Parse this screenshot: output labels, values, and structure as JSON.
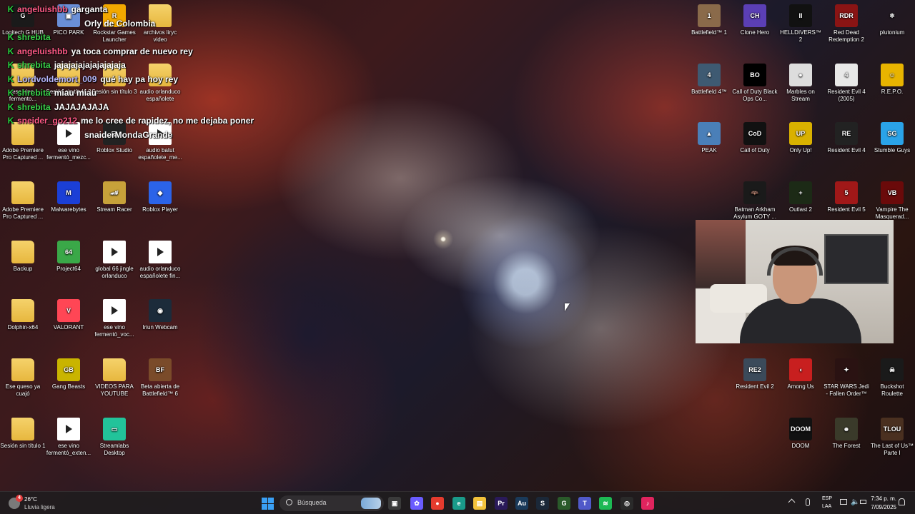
{
  "desktop_icons": [
    {
      "label": "Logitech G HUB",
      "kind": "app",
      "color": "#1a1a1a",
      "glyph": "G"
    },
    {
      "label": "PICO PARK",
      "kind": "app",
      "color": "#6a8fd8",
      "glyph": "▣"
    },
    {
      "label": "Rockstar Games Launcher",
      "kind": "app",
      "color": "#f2a800",
      "glyph": "R"
    },
    {
      "label": "archivos liryc video",
      "kind": "folder",
      "color": "",
      "glyph": ""
    },
    {
      "label": "ese vino fermento...",
      "kind": "folder",
      "color": "",
      "glyph": ""
    },
    {
      "label": "Sesión sin título 2",
      "kind": "folder",
      "color": "",
      "glyph": ""
    },
    {
      "label": "Sesión sin título 3",
      "kind": "folder",
      "color": "",
      "glyph": ""
    },
    {
      "label": "audio orlanduco españolete",
      "kind": "folder",
      "color": "",
      "glyph": ""
    },
    {
      "label": "Adobe Premiere Pro Captured ...",
      "kind": "folder",
      "color": "",
      "glyph": ""
    },
    {
      "label": "ese vino fermentó_mezc...",
      "kind": "video",
      "color": "",
      "glyph": ""
    },
    {
      "label": "Roblox Studio",
      "kind": "app",
      "color": "#222",
      "glyph": "◪"
    },
    {
      "label": "audio batut españolete_me...",
      "kind": "video",
      "color": "",
      "glyph": ""
    },
    {
      "label": "Adobe Premiere Pro Captured ...",
      "kind": "folder",
      "color": "",
      "glyph": ""
    },
    {
      "label": "Malwarebytes",
      "kind": "app",
      "color": "#1b3fd6",
      "glyph": "M"
    },
    {
      "label": "Stream Racer",
      "kind": "app",
      "color": "#c7a13a",
      "glyph": "🏎"
    },
    {
      "label": "Roblox Player",
      "kind": "app",
      "color": "#2b63e8",
      "glyph": "◆"
    },
    {
      "label": "Backup",
      "kind": "folder",
      "color": "",
      "glyph": ""
    },
    {
      "label": "Project64",
      "kind": "app",
      "color": "#3aa848",
      "glyph": "64"
    },
    {
      "label": "global 66 jingle orlanduco",
      "kind": "video",
      "color": "",
      "glyph": ""
    },
    {
      "label": "audio orlanduco españolete fin...",
      "kind": "video",
      "color": "",
      "glyph": ""
    },
    {
      "label": "Dolphin-x64",
      "kind": "folder",
      "color": "",
      "glyph": ""
    },
    {
      "label": "VALORANT",
      "kind": "app",
      "color": "#ff4655",
      "glyph": "V"
    },
    {
      "label": "ese vino fermentó_voc...",
      "kind": "video",
      "color": "",
      "glyph": ""
    },
    {
      "label": "Iriun Webcam",
      "kind": "app",
      "color": "#1c2b3a",
      "glyph": "◉"
    },
    {
      "label": "Ese queso ya cuajó",
      "kind": "folder",
      "color": "",
      "glyph": ""
    },
    {
      "label": "Gang Beasts",
      "kind": "app",
      "color": "#c9b400",
      "glyph": "GB"
    },
    {
      "label": "VIDEOS PARA YOUTUBE",
      "kind": "folder",
      "color": "",
      "glyph": ""
    },
    {
      "label": "Beta abierta de Battlefield™ 6",
      "kind": "app",
      "color": "#7a4b2a",
      "glyph": "BF"
    },
    {
      "label": "Sesión sin título 1",
      "kind": "folder",
      "color": "",
      "glyph": ""
    },
    {
      "label": "ese vino fermentó_exten...",
      "kind": "video",
      "color": "",
      "glyph": ""
    },
    {
      "label": "Streamlabs Desktop",
      "kind": "app",
      "color": "#22c39a",
      "glyph": "▭"
    },
    {
      "label": "Battlefield™ 1",
      "kind": "app",
      "color": "#8a6a4a",
      "glyph": "1"
    },
    {
      "label": "Clone Hero",
      "kind": "app",
      "color": "#5b3fb5",
      "glyph": "CH"
    },
    {
      "label": "HELLDIVERS™ 2",
      "kind": "app",
      "color": "#111",
      "glyph": "II"
    },
    {
      "label": "Red Dead Redemption 2",
      "kind": "app",
      "color": "#8a1414",
      "glyph": "RDR"
    },
    {
      "label": "plutonium",
      "kind": "app",
      "color": "transparent",
      "glyph": "⚛"
    },
    {
      "label": "Battlefield 4™",
      "kind": "app",
      "color": "#3e5a72",
      "glyph": "4"
    },
    {
      "label": "Call of Duty Black Ops Co...",
      "kind": "app",
      "color": "#000",
      "glyph": "BO"
    },
    {
      "label": "Marbles on Stream",
      "kind": "app",
      "color": "#ddd",
      "glyph": "●"
    },
    {
      "label": "Resident Evil 4 (2005)",
      "kind": "app",
      "color": "#e8e8e8",
      "glyph": "4"
    },
    {
      "label": "R.E.P.O.",
      "kind": "app",
      "color": "#e8b400",
      "glyph": "☺"
    },
    {
      "label": "PEAK",
      "kind": "app",
      "color": "#4a7fb8",
      "glyph": "▲"
    },
    {
      "label": "Call of Duty",
      "kind": "app",
      "color": "#111",
      "glyph": "CoD"
    },
    {
      "label": "Only Up!",
      "kind": "app",
      "color": "#d9b100",
      "glyph": "UP"
    },
    {
      "label": "Resident Evil 4",
      "kind": "app",
      "color": "#222",
      "glyph": "RE"
    },
    {
      "label": "Stumble Guys",
      "kind": "app",
      "color": "#2aa3e8",
      "glyph": "SG"
    },
    {
      "label": "Batman Arkham Asylum GOTY ...",
      "kind": "app",
      "color": "#1a1a1a",
      "glyph": "🦇"
    },
    {
      "label": "Outlast 2",
      "kind": "app",
      "color": "#1c2a16",
      "glyph": "+"
    },
    {
      "label": "Resident Evil 5",
      "kind": "app",
      "color": "#a01818",
      "glyph": "5"
    },
    {
      "label": "Vampire The Masquerad...",
      "kind": "app",
      "color": "#6a0a0a",
      "glyph": "VB"
    },
    {
      "label": "Resident Evil 2",
      "kind": "app",
      "color": "#3b4a5a",
      "glyph": "RE2"
    },
    {
      "label": "Among Us",
      "kind": "app",
      "color": "#c81f1f",
      "glyph": "◖"
    },
    {
      "label": "STAR WARS Jedi - Fallen Order™",
      "kind": "app",
      "color": "#2a1212",
      "glyph": "✦"
    },
    {
      "label": "Buckshot Roulette",
      "kind": "app",
      "color": "#1a1a1a",
      "glyph": "☠"
    },
    {
      "label": "DOOM",
      "kind": "app",
      "color": "#111",
      "glyph": "DOOM"
    },
    {
      "label": "The Forest",
      "kind": "app",
      "color": "#3a3a2a",
      "glyph": "☻"
    },
    {
      "label": "The Last of Us™ Parte I",
      "kind": "app",
      "color": "#4a3020",
      "glyph": "TLOU"
    }
  ],
  "chat": [
    {
      "user": "angeluishbb",
      "user_color": "#ff5a86",
      "text": "garganta"
    },
    {
      "user": "",
      "user_color": "#ff5a86",
      "text": "Orly de Colombia"
    },
    {
      "user": "shrebita",
      "user_color": "#3ad14a",
      "text": ""
    },
    {
      "user": "angeluishbb",
      "user_color": "#ff5a86",
      "text": "ya toca comprar de nuevo rey"
    },
    {
      "user": "shrebita",
      "user_color": "#3ad14a",
      "text": "jajajajajajajajajaja"
    },
    {
      "user": "Lordvoldemort_009",
      "user_color": "#b9b9ff",
      "text": "qué hay pa hoy rey"
    },
    {
      "user": "shrebita",
      "user_color": "#3ad14a",
      "text": "miau miau"
    },
    {
      "user": "shrebita",
      "user_color": "#3ad14a",
      "text": "JAJAJAJAJA"
    },
    {
      "user": "sneider_go212",
      "user_color": "#ff5a86",
      "text": "me lo cree de rapidez, no me dejaba poner"
    },
    {
      "user": "",
      "user_color": "#ff5a86",
      "text": "snaiderMondaGrande"
    }
  ],
  "taskbar": {
    "weather_temp": "26°C",
    "weather_desc": "Lluvia ligera",
    "weather_badge": "4",
    "search_placeholder": "Búsqueda",
    "language_top": "ESP",
    "language_bottom": "LAA",
    "time": "7:34 p. m.",
    "date": "7/09/2025",
    "pinned": [
      {
        "name": "task-view",
        "color": "#3a3a3a",
        "glyph": "▣"
      },
      {
        "name": "copilot",
        "color": "#6a5cff",
        "glyph": "✿"
      },
      {
        "name": "chrome",
        "color": "#e53b2e",
        "glyph": "●"
      },
      {
        "name": "edge",
        "color": "#1a9b8a",
        "glyph": "e"
      },
      {
        "name": "file-explorer",
        "color": "#f2c23b",
        "glyph": "▤"
      },
      {
        "name": "premiere-pro",
        "color": "#2a1a5a",
        "glyph": "Pr"
      },
      {
        "name": "audition",
        "color": "#1a3a5a",
        "glyph": "Au"
      },
      {
        "name": "steam",
        "color": "#1b2838",
        "glyph": "S"
      },
      {
        "name": "g-hub",
        "color": "#2a5a2a",
        "glyph": "G"
      },
      {
        "name": "teams",
        "color": "#5059c9",
        "glyph": "T"
      },
      {
        "name": "spotify",
        "color": "#1db954",
        "glyph": "≋"
      },
      {
        "name": "obs",
        "color": "#2a2a2a",
        "glyph": "◎"
      },
      {
        "name": "tiktok",
        "color": "#e0245e",
        "glyph": "♪"
      }
    ]
  }
}
